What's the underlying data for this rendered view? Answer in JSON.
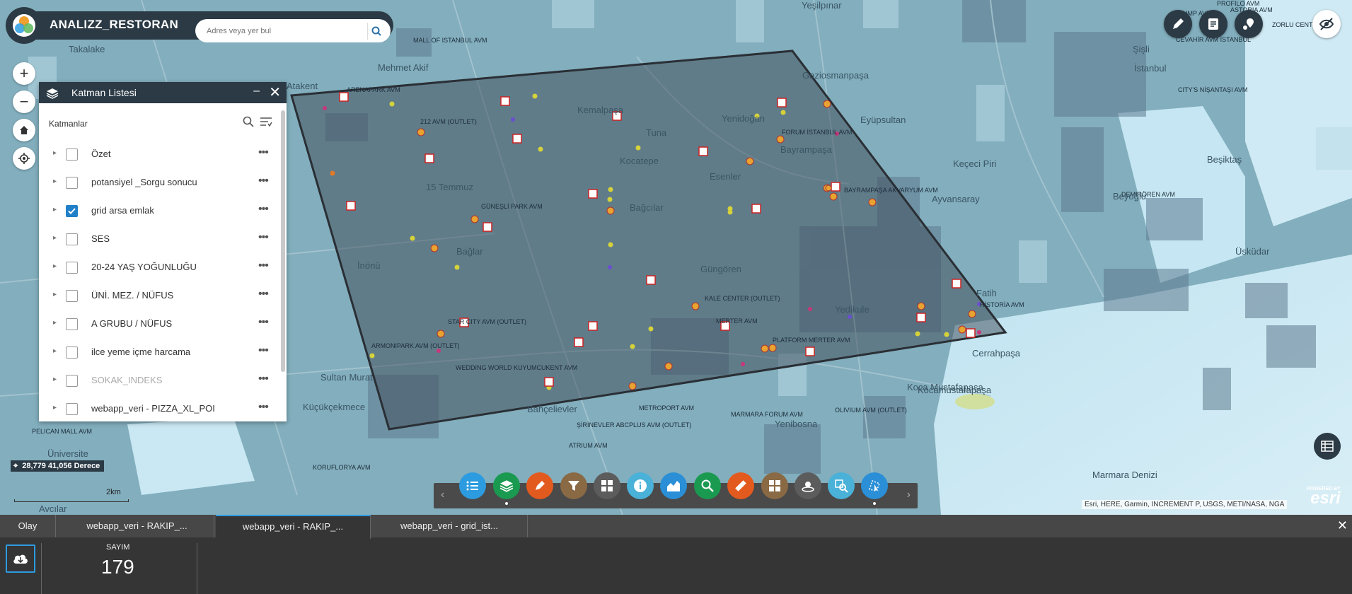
{
  "app": {
    "title": "ANALIZZ_RESTORAN"
  },
  "search": {
    "placeholder": "Adres veya yer bul"
  },
  "layer_panel": {
    "title": "Katman Listesi",
    "subtitle": "Katmanlar",
    "layers": [
      {
        "label": "Özet",
        "checked": false,
        "dim": false
      },
      {
        "label": "potansiyel _Sorgu sonucu",
        "checked": false,
        "dim": false
      },
      {
        "label": "grid arsa emlak",
        "checked": true,
        "dim": false
      },
      {
        "label": "SES",
        "checked": false,
        "dim": false
      },
      {
        "label": "20-24 YAŞ YOĞUNLUĞU",
        "checked": false,
        "dim": false
      },
      {
        "label": "ÜNİ. MEZ. / NÜFUS",
        "checked": false,
        "dim": false
      },
      {
        "label": "A GRUBU / NÜFUS",
        "checked": false,
        "dim": false
      },
      {
        "label": "ilce yeme içme harcama",
        "checked": false,
        "dim": false
      },
      {
        "label": "SOKAK_INDEKS",
        "checked": false,
        "dim": true
      },
      {
        "label": "webapp_veri - PIZZA_XL_POI",
        "checked": false,
        "dim": false
      }
    ]
  },
  "map_labels": [
    {
      "text": "ARENAPARK AVM"
    },
    {
      "text": "MALL OF ISTANBUL AVM"
    },
    {
      "text": "212 AVM (OUTLET)"
    },
    {
      "text": "FORUM İSTANBUL AVM"
    },
    {
      "text": "BAYRAMPAŞA AKVARYUM AVM"
    },
    {
      "text": "GÜNEŞLİ PARK AVM"
    },
    {
      "text": "KALE CENTER (OUTLET)"
    },
    {
      "text": "MERTER AVM"
    },
    {
      "text": "PLATFORM MERTER AVM"
    },
    {
      "text": "STAR CITY AVM (OUTLET)"
    },
    {
      "text": "ARMONIPARK AVM (OUTLET)"
    },
    {
      "text": "WEDDING WORLD KUYUMCUKENT AVM"
    },
    {
      "text": "METROPORT AVM"
    },
    {
      "text": "MARMARA FORUM AVM"
    },
    {
      "text": "OLIVIUM AVM (OUTLET)"
    },
    {
      "text": "ŞİRİNEVLER ABCPLUS AVM (OUTLET)"
    },
    {
      "text": "ATRIUM AVM"
    },
    {
      "text": "PELICAN MALL AVM"
    },
    {
      "text": "KORUFLORYA AVM"
    },
    {
      "text": "HİSTORİA AVM"
    },
    {
      "text": "DEMIRÖREN AVM"
    },
    {
      "text": "CITY'S NİŞANTAŞI AVM"
    },
    {
      "text": "CEVAHİR AVM İSTANBUL"
    },
    {
      "text": "ASTORIA AVM"
    },
    {
      "text": "ZORLU CENTER"
    },
    {
      "text": "PROFILO AVM"
    },
    {
      "text": "TRUMP AVM"
    }
  ],
  "place_labels": [
    {
      "text": "Gaziosmanpaşa"
    },
    {
      "text": "Şişli"
    },
    {
      "text": "İstanbul"
    },
    {
      "text": "Eyüpsultan"
    },
    {
      "text": "Bayrampaşa"
    },
    {
      "text": "Esenler"
    },
    {
      "text": "Bağcılar"
    },
    {
      "text": "Güngören"
    },
    {
      "text": "Kemalpaşa"
    },
    {
      "text": "15 Temmuz"
    },
    {
      "text": "Bağlar"
    },
    {
      "text": "İnönü"
    },
    {
      "text": "Sultan Murat"
    },
    {
      "text": "Küçükçekmece"
    },
    {
      "text": "Bahçelievler"
    },
    {
      "text": "Yenibosna"
    },
    {
      "text": "Fatih"
    },
    {
      "text": "Cerrahpaşa"
    },
    {
      "text": "Üsküdar"
    },
    {
      "text": "Beşiktaş"
    },
    {
      "text": "Beyoğlu"
    },
    {
      "text": "Kocamustafapaşa"
    },
    {
      "text": "Marmara Denizi"
    },
    {
      "text": "Mehmet Akif"
    },
    {
      "text": "Takalake"
    },
    {
      "text": "Avcılar"
    },
    {
      "text": "Keçeci Piri"
    },
    {
      "text": "Ayvansaray"
    },
    {
      "text": "Yeşilpınar"
    },
    {
      "text": "Atakent"
    },
    {
      "text": "Koca Mustafapaşa"
    },
    {
      "text": "Yenidoğan"
    },
    {
      "text": "Tuna"
    },
    {
      "text": "Kocatepe"
    },
    {
      "text": "Üniversite"
    },
    {
      "text": "Yedikule"
    }
  ],
  "status": {
    "coords": "28,779 41,056 Derece",
    "scale": "2km"
  },
  "attribution": "Esri, HERE, Garmin, INCREMENT P, USGS, METI/NASA, NGA",
  "esri": {
    "powered": "POWERED BY",
    "brand": "esri"
  },
  "bottom": {
    "tabs": [
      "Olay",
      "webapp_veri - RAKIP_...",
      "webapp_veri - RAKIP_...",
      "webapp_veri - grid_ist..."
    ],
    "stat_label": "SAYIM",
    "stat_value": "179"
  },
  "colors": {
    "header": "#2b3a45",
    "accent": "#2d9be0",
    "polygon": "#3d4a55"
  },
  "toolbar_icons": [
    "list-icon",
    "layers-icon",
    "draw-icon",
    "filter-icon",
    "basemap-icon",
    "info-icon",
    "chart-icon",
    "query-icon",
    "measure-icon",
    "grid-icon",
    "locate-icon",
    "analysis-icon",
    "select-icon"
  ]
}
